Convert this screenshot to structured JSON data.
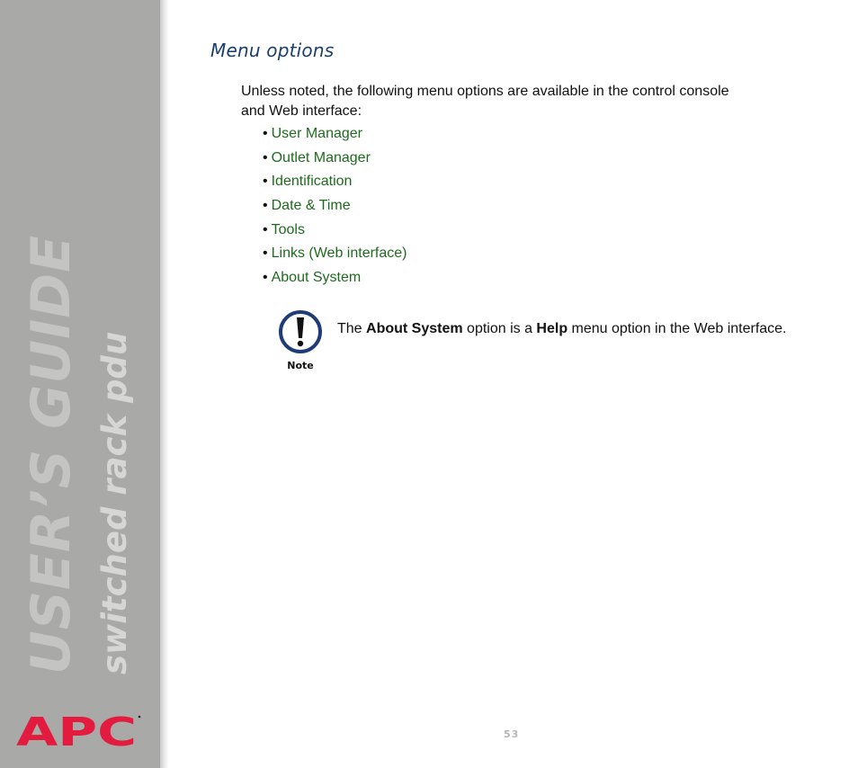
{
  "sidebar": {
    "title": "USER’S GUIDE",
    "subtitle": "switched rack pdu",
    "logo_text": "APC",
    "logo_color": "#e31b3f",
    "background_color": "#a9a9a8"
  },
  "heading": "Menu options",
  "intro": "Unless noted, the following menu options are available in the control console and Web interface:",
  "menu_items": [
    {
      "bullet": "•",
      "label": "User Manager"
    },
    {
      "bullet": "•",
      "label": "Outlet Manager"
    },
    {
      "bullet": "•",
      "label": "Identification"
    },
    {
      "bullet": "•",
      "label": "Date & Time"
    },
    {
      "bullet": "•",
      "label": "Tools"
    },
    {
      "bullet": "•",
      "label": "Links (Web interface)"
    },
    {
      "bullet": "•",
      "label": "About System"
    }
  ],
  "note": {
    "icon": "exclamation-circle-icon",
    "icon_label": "Note",
    "text_prefix": "The ",
    "bold1": "About System",
    "text_middle": " option is a ",
    "bold2": "Help",
    "text_suffix": " menu option in the Web interface."
  },
  "page_number": "53",
  "colors": {
    "heading": "#1a3e6e",
    "link": "#1e6b1e",
    "note_ring": "#1f3c78"
  }
}
